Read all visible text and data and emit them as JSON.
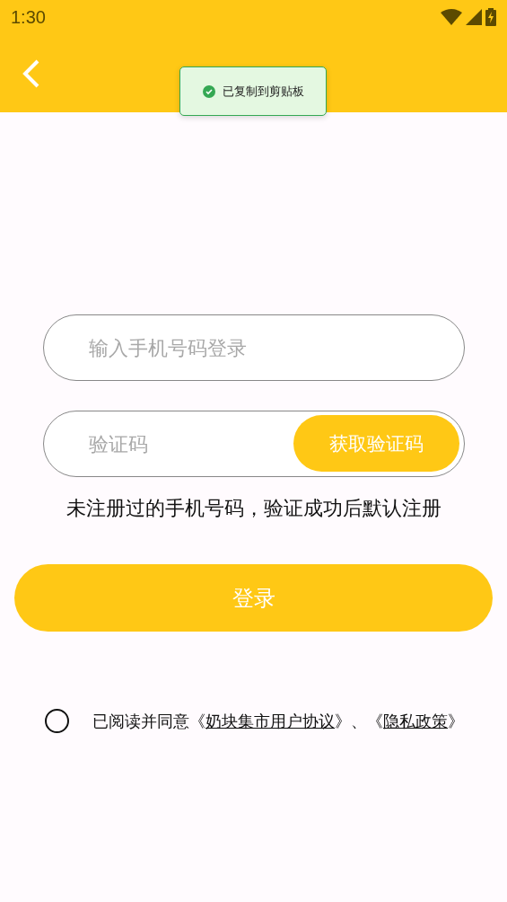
{
  "status_bar": {
    "time": "1:30"
  },
  "toast": {
    "message": "已复制到剪贴板"
  },
  "phone_field": {
    "placeholder": "输入手机号码登录"
  },
  "code_field": {
    "placeholder": "验证码",
    "button": "获取验证码"
  },
  "hint": "未注册过的手机号码，验证成功后默认注册",
  "login_button": "登录",
  "agreement": {
    "checked": false,
    "parts": [
      {
        "kind": "text",
        "text": "已阅读并同意《"
      },
      {
        "kind": "link",
        "text": "奶块集市用户协议"
      },
      {
        "kind": "text",
        "text": "》、《"
      },
      {
        "kind": "link",
        "text": "隐私政策"
      },
      {
        "kind": "text",
        "text": "》"
      }
    ]
  }
}
